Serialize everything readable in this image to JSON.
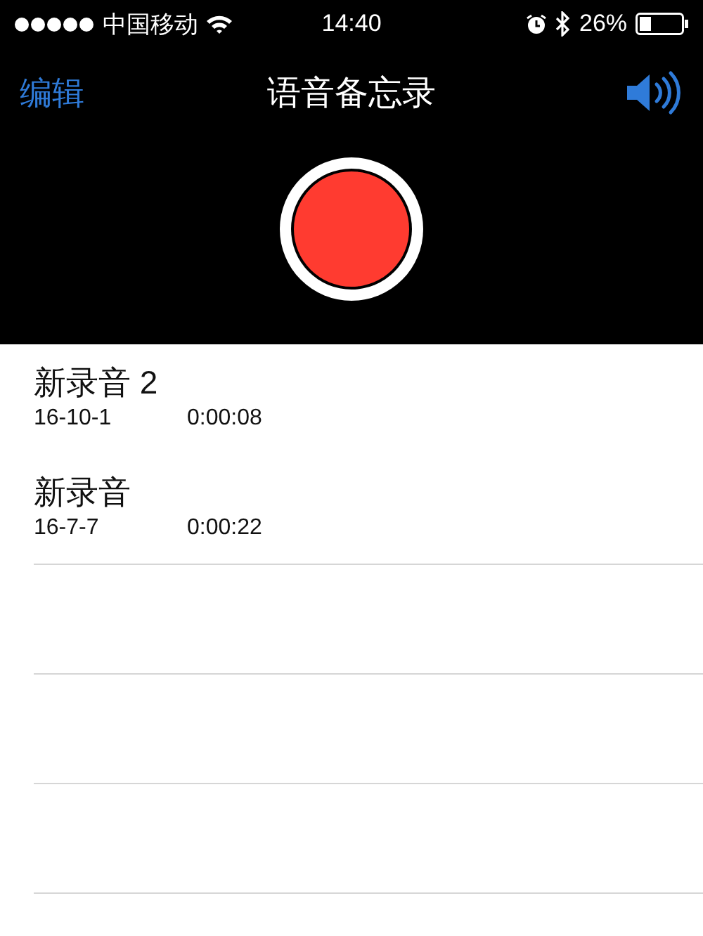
{
  "status_bar": {
    "carrier": "中国移动",
    "time": "14:40",
    "battery": "26%"
  },
  "nav_bar": {
    "left_button": "编辑",
    "title": "语音备忘录"
  },
  "recordings": [
    {
      "name": "新录音 2",
      "date": "16-10-1",
      "duration": "0:00:08"
    },
    {
      "name": "新录音",
      "date": "16-7-7",
      "duration": "0:00:22"
    }
  ]
}
